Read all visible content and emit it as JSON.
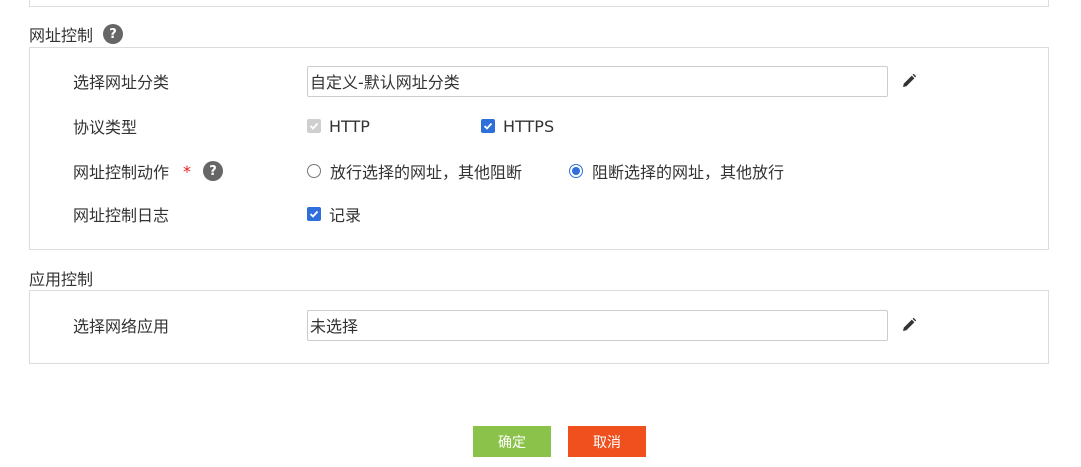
{
  "url_control": {
    "title": "网址控制",
    "category": {
      "label": "选择网址分类",
      "value": "自定义-默认网址分类"
    },
    "protocol": {
      "label": "协议类型",
      "http": "HTTP",
      "https": "HTTPS",
      "http_checked": true,
      "http_disabled": true,
      "https_checked": true
    },
    "action": {
      "label": "网址控制动作",
      "required_mark": "*",
      "option_allow": "放行选择的网址，其他阻断",
      "option_block": "阻断选择的网址，其他放行",
      "selected": "block"
    },
    "log": {
      "label": "网址控制日志",
      "option": "记录",
      "checked": true
    }
  },
  "app_control": {
    "title": "应用控制",
    "app": {
      "label": "选择网络应用",
      "value": "未选择"
    }
  },
  "buttons": {
    "ok": "确定",
    "cancel": "取消"
  },
  "colors": {
    "accent": "#2f6fdb",
    "ok": "#8bc34a",
    "cancel": "#f0501e",
    "required": "#e02020"
  }
}
